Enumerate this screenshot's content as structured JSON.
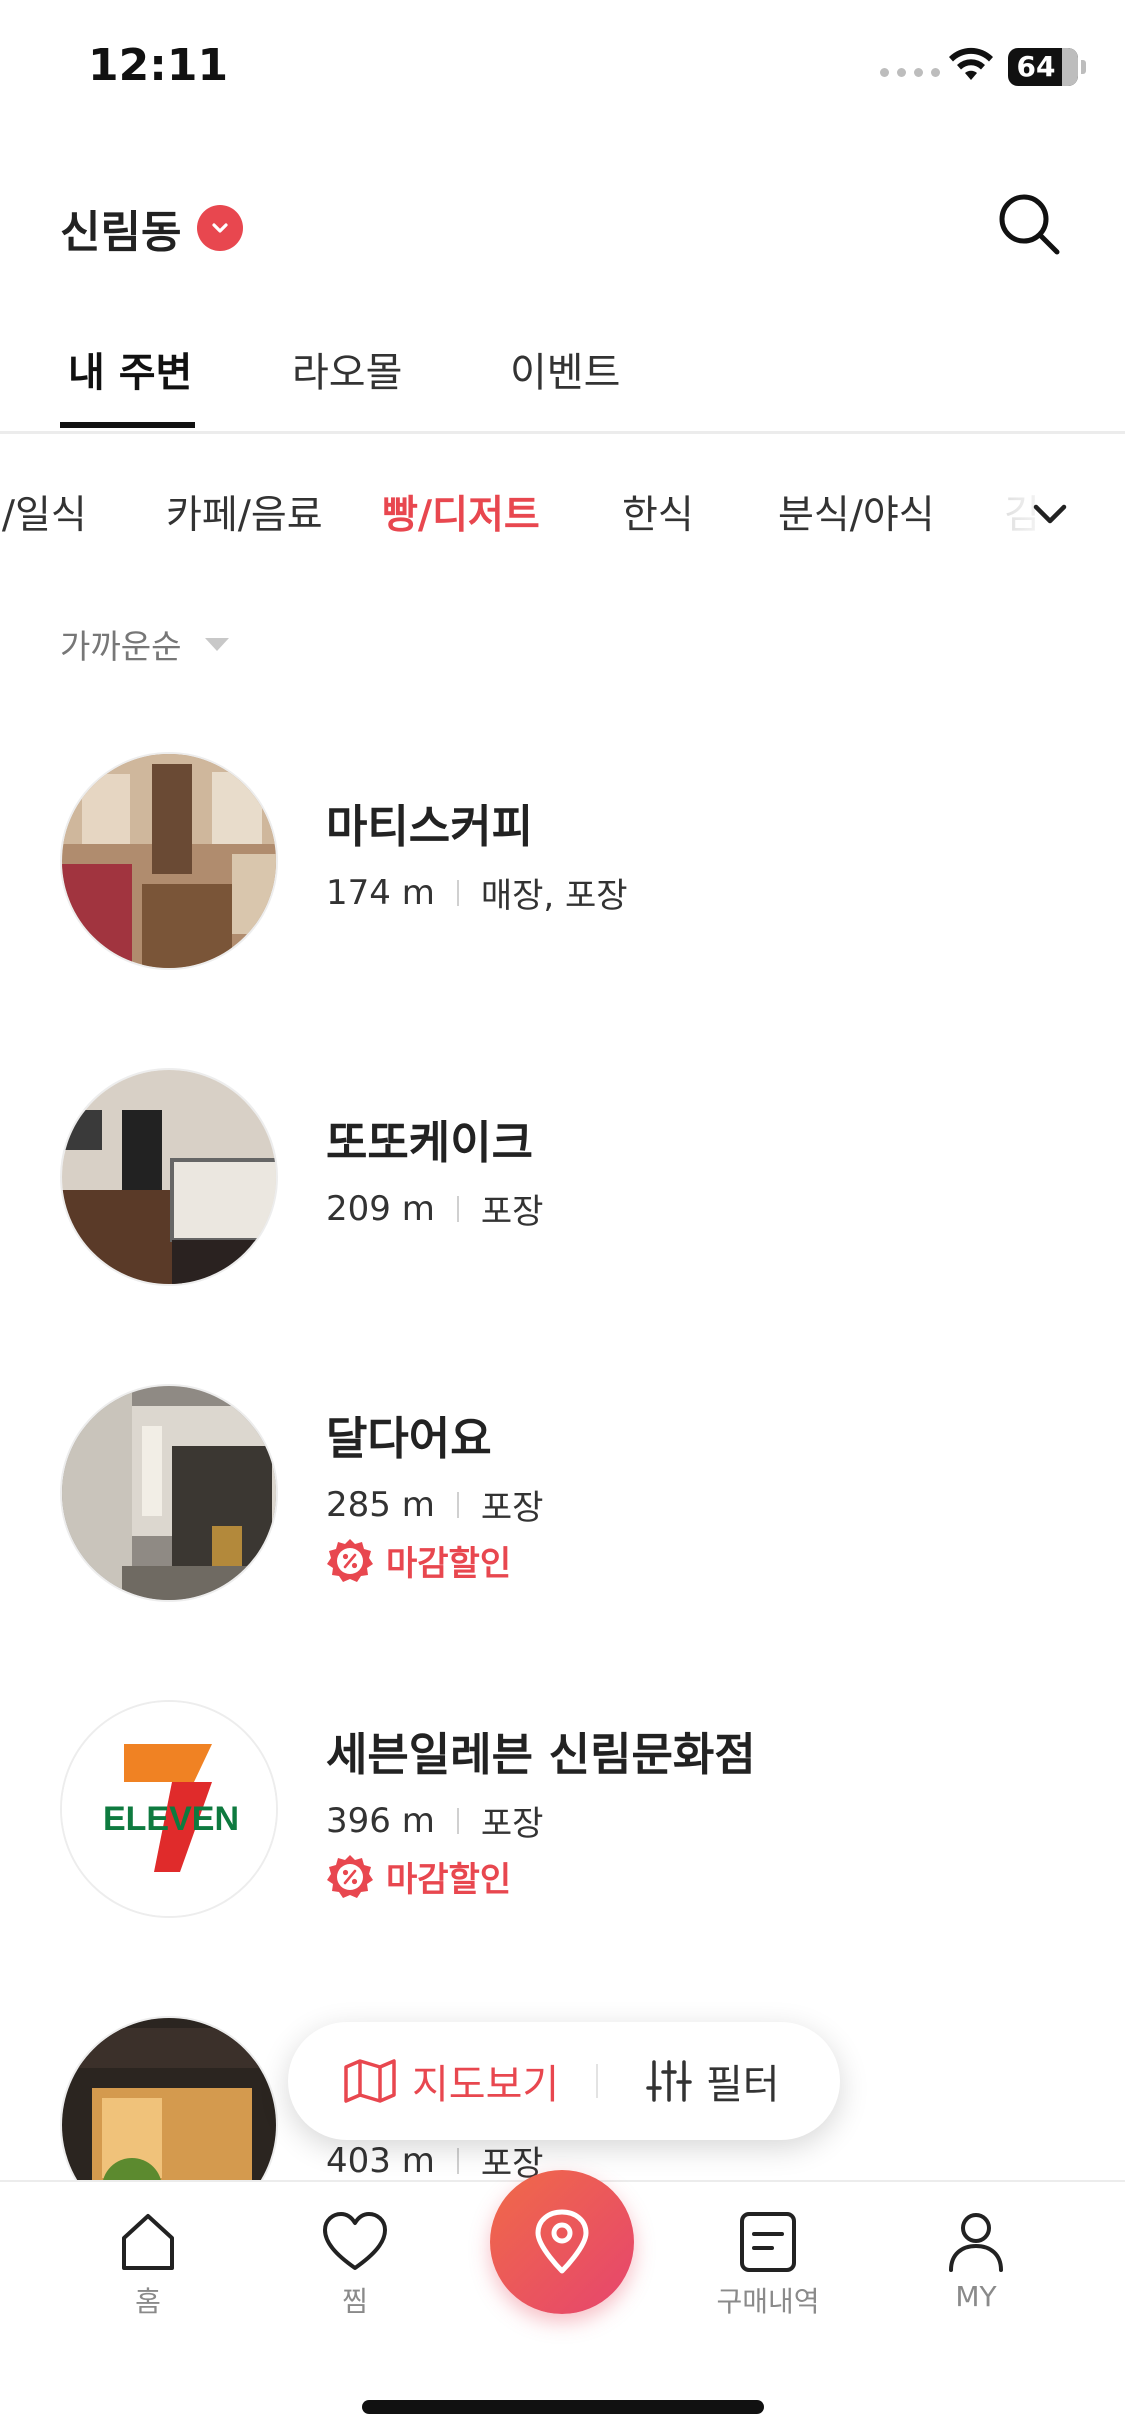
{
  "status_bar": {
    "time": "12:11",
    "battery": "64"
  },
  "header": {
    "location": "신림동"
  },
  "tabs": [
    {
      "label": "내 주변",
      "active": true
    },
    {
      "label": "라오몰",
      "active": false
    },
    {
      "label": "이벤트",
      "active": false
    }
  ],
  "categories": [
    {
      "label": "피/일식",
      "active": false
    },
    {
      "label": "카페/음료",
      "active": false
    },
    {
      "label": "빵/디저트",
      "active": true
    },
    {
      "label": "한식",
      "active": false
    },
    {
      "label": "분식/야식",
      "active": false
    },
    {
      "label": "김",
      "active": false
    }
  ],
  "sort": {
    "label": "가까운순"
  },
  "stores": [
    {
      "name": "마티스커피",
      "distance": "174 m",
      "service": "매장, 포장",
      "discount": ""
    },
    {
      "name": "또또케이크",
      "distance": "209 m",
      "service": "포장",
      "discount": ""
    },
    {
      "name": "달다어요",
      "distance": "285 m",
      "service": "포장",
      "discount": "마감할인"
    },
    {
      "name": "세븐일레븐 신림문화점",
      "distance": "396 m",
      "service": "포장",
      "discount": "마감할인"
    },
    {
      "name": "",
      "distance": "403 m",
      "service": "포장",
      "discount": ""
    }
  ],
  "floating": {
    "map_label": "지도보기",
    "filter_label": "필터"
  },
  "bottom_nav": [
    {
      "label": "홈",
      "icon": "home-icon"
    },
    {
      "label": "찜",
      "icon": "heart-icon"
    },
    {
      "label": "",
      "icon": "location-pin-icon"
    },
    {
      "label": "구매내역",
      "icon": "receipt-icon"
    },
    {
      "label": "MY",
      "icon": "person-icon"
    }
  ],
  "colors": {
    "accent": "#e8474f",
    "text": "#222222",
    "muted": "#8a8a8a"
  },
  "seven_eleven_logo": "ELEVEN"
}
